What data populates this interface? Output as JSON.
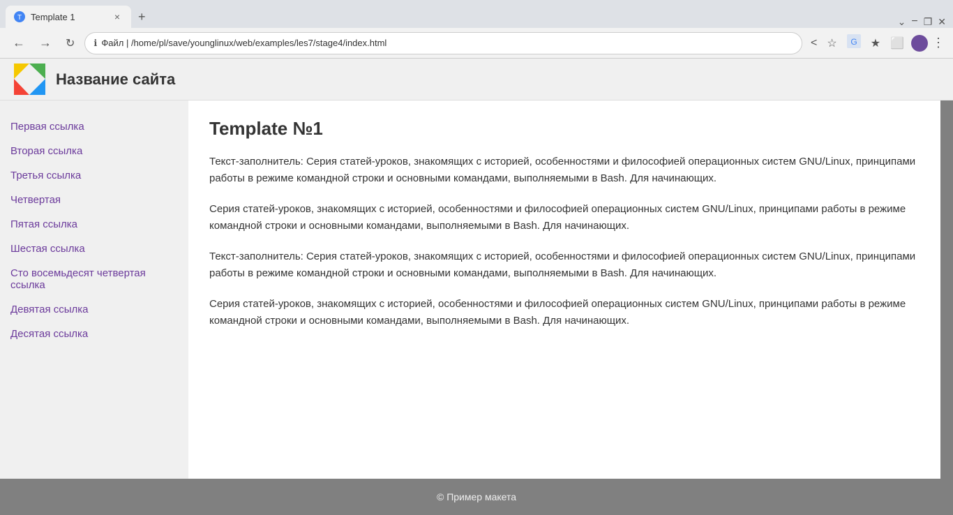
{
  "browser": {
    "tab_title": "Template 1",
    "tab_close": "×",
    "new_tab": "+",
    "win_minimize": "−",
    "win_maximize": "❐",
    "win_close": "✕",
    "win_controls_label": "⌄",
    "url": "/home/pl/save/younglinux/web/examples/les7/stage4/index.html",
    "url_protocol": "Файл",
    "back": "←",
    "forward": "→",
    "reload": "↻",
    "addr_icons": [
      "<",
      "☆",
      "🌐",
      "★",
      "⬜"
    ]
  },
  "site": {
    "logo_alt": "site logo",
    "title": "Название сайта",
    "nav_links": [
      "Первая ссылка",
      "Вторая ссылка",
      "Третья ссылка",
      "Четвертая",
      "Пятая ссылка",
      "Шестая ссылка",
      "Сто восемьдесят четвертая ссылка",
      "Девятая ссылка",
      "Десятая ссылка"
    ],
    "heading": "Template №1",
    "paragraphs": [
      "Текст-заполнитель: Серия статей-уроков, знакомящих с историей, особенностями и философией операционных систем GNU/Linux, принципами работы в режиме командной строки и основными командами, выполняемыми в Bash. Для начинающих.",
      "Серия статей-уроков, знакомящих с историей, особенностями и философией операционных систем GNU/Linux, принципами работы в режиме командной строки и основными командами, выполняемыми в Bash. Для начинающих.",
      "Текст-заполнитель: Серия статей-уроков, знакомящих с историей, особенностями и философией операционных систем GNU/Linux, принципами работы в режиме командной строки и основными командами, выполняемыми в Bash. Для начинающих.",
      "Серия статей-уроков, знакомящих с историей, особенностями и философией операционных систем GNU/Linux, принципами работы в режиме командной строки и основными командами, выполняемыми в Bash. Для начинающих."
    ],
    "footer": "© Пример макета"
  }
}
